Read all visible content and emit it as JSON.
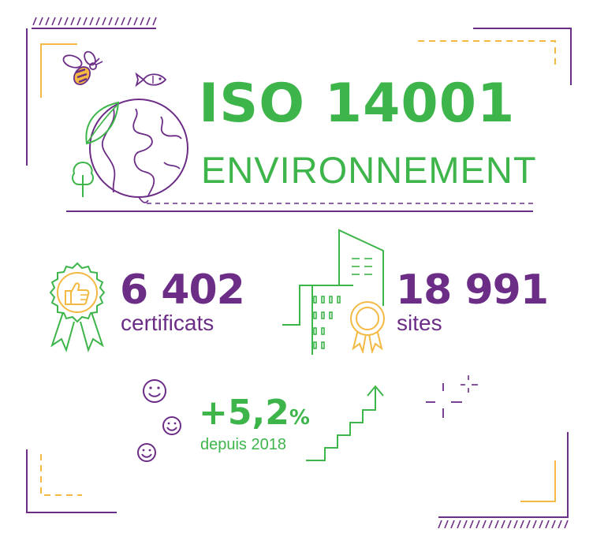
{
  "header": {
    "title": "ISO 14001",
    "subtitle": "ENVIRONNEMENT"
  },
  "stats": {
    "certificates": {
      "value": "6 402",
      "label": "certificats"
    },
    "sites": {
      "value": "18 991",
      "label": "sites"
    },
    "growth": {
      "value": "+5,2",
      "unit": "%",
      "label": "depuis 2018"
    }
  },
  "icons": [
    "bee-icon",
    "fish-icon",
    "globe-icon",
    "leaf-icon",
    "tree-icon",
    "award-rosette-icon",
    "thumbs-up-icon",
    "buildings-icon",
    "medal-icon",
    "smiley-icon",
    "stairs-arrow-icon",
    "sparkle-icon"
  ],
  "colors": {
    "green": "#3db54a",
    "purple": "#6b2d86",
    "yellow": "#f4b942"
  }
}
